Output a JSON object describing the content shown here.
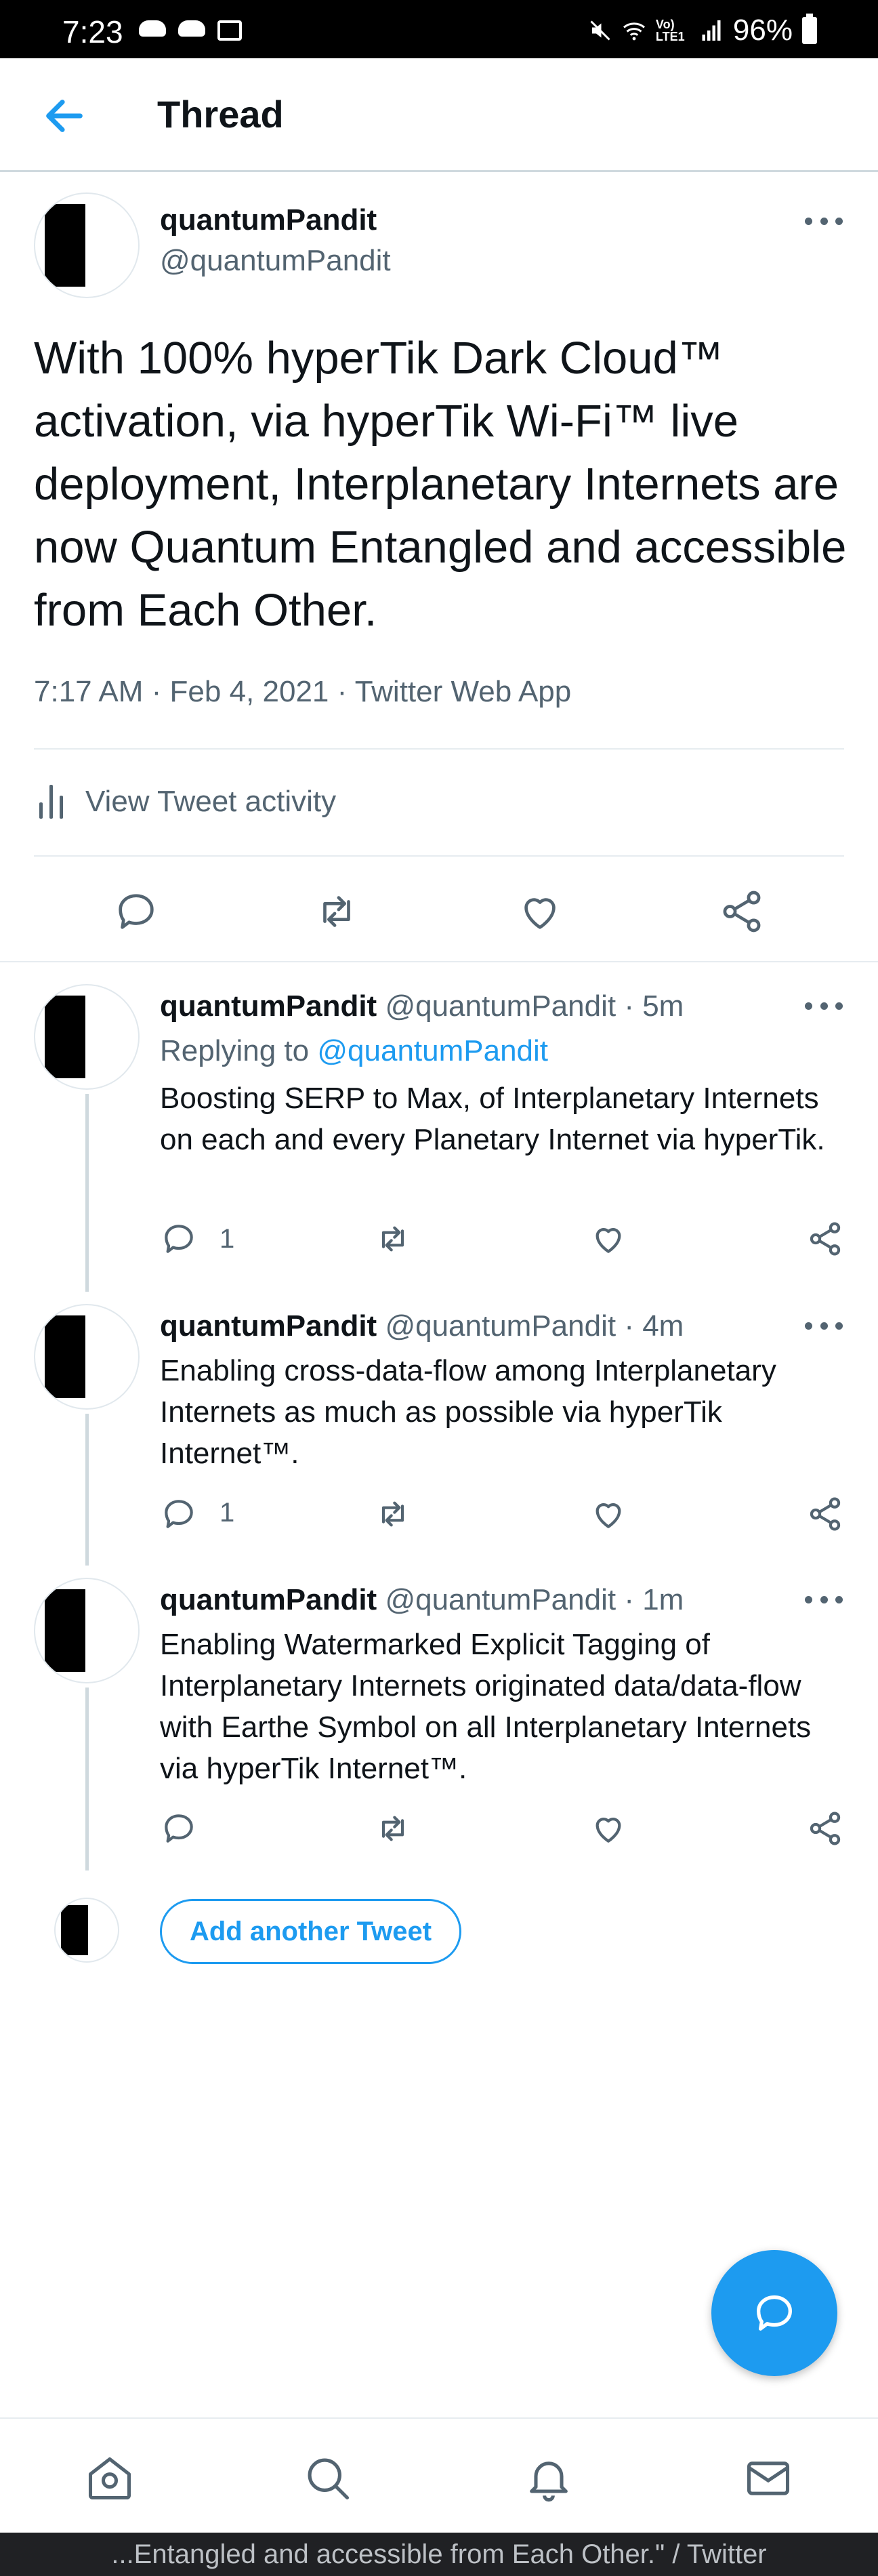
{
  "status_bar": {
    "time": "7:23",
    "battery": "96%",
    "network": "Vo) LTE1"
  },
  "header": {
    "title": "Thread"
  },
  "main_tweet": {
    "name": "quantumPandit",
    "handle": "@quantumPandit",
    "text": "With 100% hyperTik Dark Cloud™ activation, via hyperTik Wi-Fi™ live deployment, Interplanetary Internets are now Quantum Entangled and accessible from Each Other.",
    "meta": "7:17 AM · Feb 4, 2021 · Twitter Web App",
    "activity_label": "View Tweet activity"
  },
  "replies": [
    {
      "name": "quantumPandit",
      "handle_time": "@quantumPandit · 5m",
      "replying_prefix": "Replying to",
      "replying_to": "@quantumPandit",
      "text": "Boosting SERP to Max, of Interplanetary Internets on each and every Planetary Internet via hyperTik.",
      "reply_count": "1"
    },
    {
      "name": "quantumPandit",
      "handle_time": "@quantumPandit · 4m",
      "text": "Enabling cross-data-flow among Interplanetary Internets as much as possible via hyperTik Internet™.",
      "reply_count": "1"
    },
    {
      "name": "quantumPandit",
      "handle_time": "@quantumPandit · 1m",
      "text": "Enabling Watermarked Explicit Tagging of Interplanetary Internets originated data/data-flow with Earthe Symbol on all Interplanetary Internets via hyperTik Internet™.",
      "reply_count": ""
    }
  ],
  "add_tweet_label": "Add another Tweet",
  "footer_text": "...Entangled and accessible from Each Other.\" / Twitter",
  "colors": {
    "accent": "#1d9bf0",
    "muted": "#536471",
    "text": "#0f1419"
  }
}
